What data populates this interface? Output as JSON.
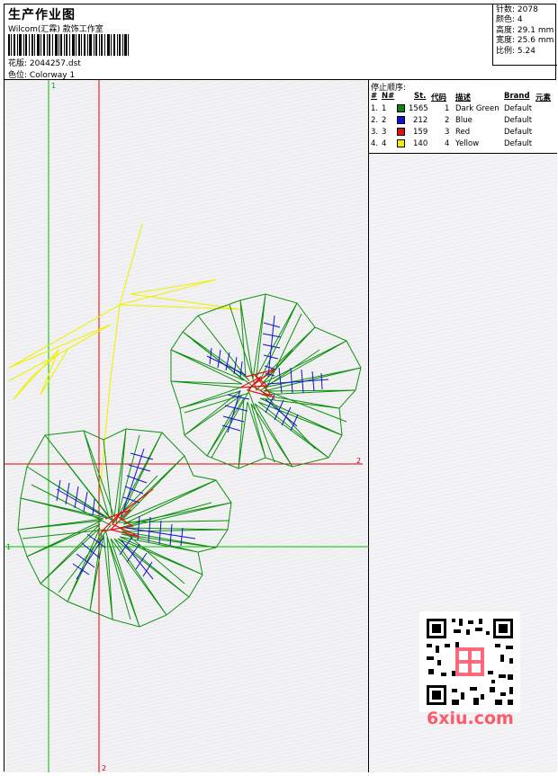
{
  "header": {
    "title": "生产作业图",
    "studio": "Wilcom(汇霖) 款饰工作室",
    "design_label": "花版:",
    "design_value": "2044257.dst",
    "colorway_label": "色位:",
    "colorway_value": "Colorway 1"
  },
  "stats": {
    "stitches_label": "针数:",
    "stitches_value": "2078",
    "colors_label": "颜色:",
    "colors_value": "4",
    "height_label": "高度:",
    "height_value": "29.1 mm",
    "width_label": "宽度:",
    "width_value": "25.6 mm",
    "scale_label": "比例:",
    "scale_value": "5.24"
  },
  "stop_sequence": {
    "title": "停止顺序:",
    "columns": [
      "#",
      "N#",
      "St.",
      "代码",
      "描述",
      "Brand",
      "元素"
    ],
    "rows": [
      {
        "idx": "1.",
        "n": "1",
        "color": "#108010",
        "st": "1565",
        "code": "1",
        "desc": "Dark Green",
        "brand": "Default"
      },
      {
        "idx": "2.",
        "n": "2",
        "color": "#1010d0",
        "st": "212",
        "code": "2",
        "desc": "Blue",
        "brand": "Default"
      },
      {
        "idx": "3.",
        "n": "3",
        "color": "#e01010",
        "st": "159",
        "code": "3",
        "desc": "Red",
        "brand": "Default"
      },
      {
        "idx": "4.",
        "n": "4",
        "color": "#f0f000",
        "st": "140",
        "code": "4",
        "desc": "Yellow",
        "brand": "Default"
      }
    ]
  },
  "guides": {
    "green_label": "1",
    "red_label": "2"
  },
  "watermark": "6xiu.com"
}
